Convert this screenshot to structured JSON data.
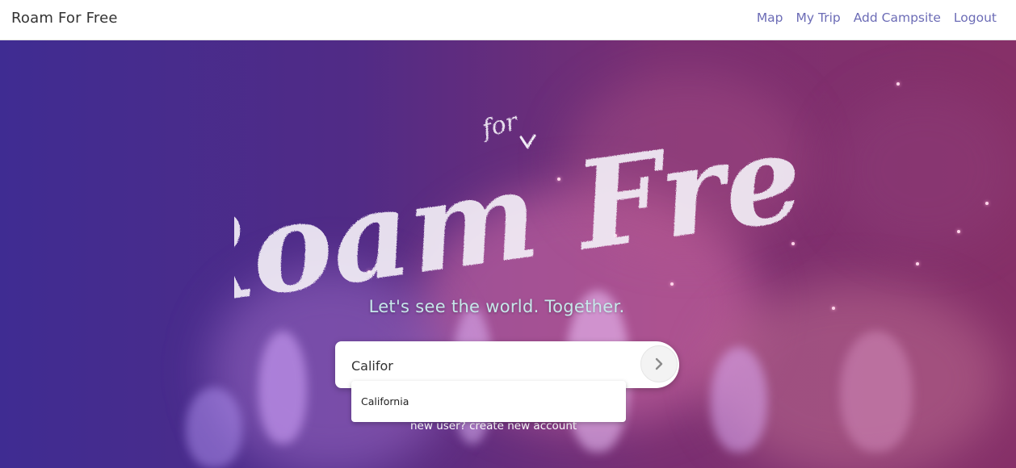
{
  "navbar": {
    "brand": "Roam For Free",
    "links": [
      {
        "label": "Map"
      },
      {
        "label": "My Trip"
      },
      {
        "label": "Add Campsite"
      },
      {
        "label": "Logout"
      }
    ]
  },
  "hero": {
    "logo": {
      "main_text": "Roam Free",
      "small_text": "for"
    },
    "tagline": "Let's see the world. Together.",
    "search": {
      "value": "Califor",
      "submit_icon": "chevron-right-icon"
    },
    "autocomplete": {
      "items": [
        "California"
      ]
    },
    "signup_link": "new user? create new account"
  },
  "colors": {
    "nav_link": "#6c6cb6",
    "brand_text": "#333333",
    "tagline": "#c7e8ea",
    "hero_left": "#3f2c92",
    "hero_right": "#863068"
  }
}
